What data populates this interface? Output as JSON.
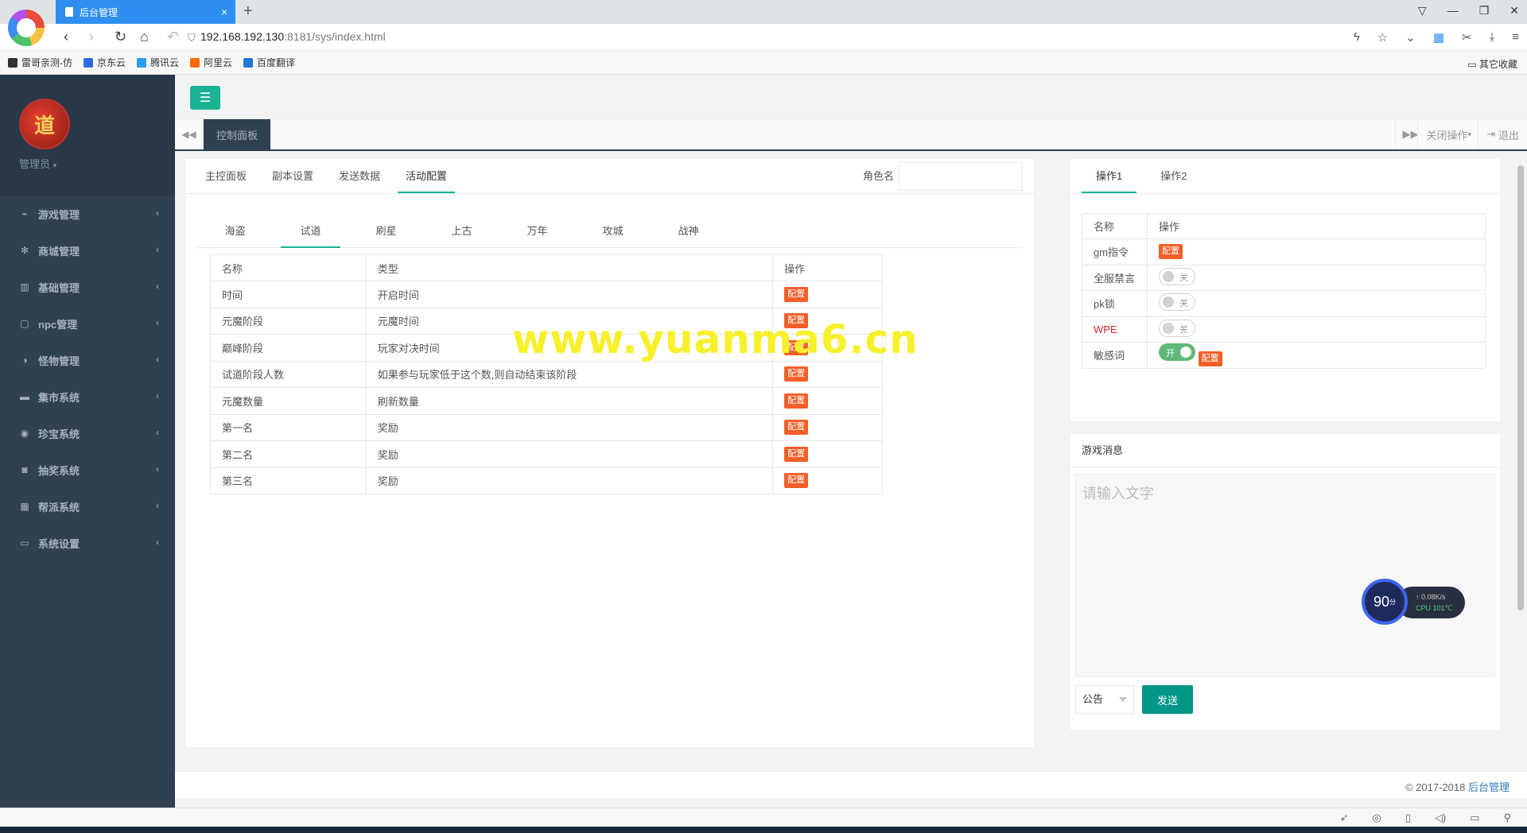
{
  "browser": {
    "tab_title": "后台管理",
    "url_host": "192.168.192.130",
    "url_rest": ":8181/sys/index.html",
    "bookmarks": [
      "雷哥亲测-仿",
      "京东云",
      "腾讯云",
      "阿里云",
      "百度翻译"
    ],
    "bookmark_colors": [
      "#333333",
      "#2b6de0",
      "#2b9af3",
      "#ff6a00",
      "#2277dd"
    ],
    "other_bookmarks": "其它收藏"
  },
  "sidebar": {
    "admin_label": "管理员",
    "avatar_text": "道",
    "items": [
      {
        "label": "游戏管理",
        "icon": "gamepad-icon",
        "glyph": "⌁"
      },
      {
        "label": "商城管理",
        "icon": "gear-icon",
        "glyph": "✻"
      },
      {
        "label": "基础管理",
        "icon": "building-icon",
        "glyph": "▥"
      },
      {
        "label": "npc管理",
        "icon": "square-icon",
        "glyph": "▢"
      },
      {
        "label": "怪物管理",
        "icon": "adjust-icon",
        "glyph": "◑"
      },
      {
        "label": "集市系统",
        "icon": "bed-icon",
        "glyph": "▬"
      },
      {
        "label": "珍宝系统",
        "icon": "target-icon",
        "glyph": "◉"
      },
      {
        "label": "抽奖系统",
        "icon": "camera-icon",
        "glyph": "◙"
      },
      {
        "label": "帮派系统",
        "icon": "grid-icon",
        "glyph": "▦"
      },
      {
        "label": "系统设置",
        "icon": "monitor-icon",
        "glyph": "▭"
      }
    ]
  },
  "topbar": {
    "hamburger_glyph": "☰",
    "active_page": "控制面板",
    "close_ops": "关闭操作",
    "logout": "退出"
  },
  "left_panel": {
    "tabs": [
      "主控面板",
      "副本设置",
      "发送数据",
      "活动配置"
    ],
    "active_tab": 3,
    "role_label": "角色名",
    "role_value": "",
    "sub_tabs": [
      "海盗",
      "试道",
      "刷星",
      "上古",
      "万年",
      "攻城",
      "战神"
    ],
    "active_sub_tab": 1,
    "table": {
      "headers": [
        "名称",
        "类型",
        "操作"
      ],
      "action_label": "配置",
      "rows": [
        {
          "name": "时间",
          "type": "开启时间"
        },
        {
          "name": "元魔阶段",
          "type": "元魔时间"
        },
        {
          "name": "巅峰阶段",
          "type": "玩家对决时间"
        },
        {
          "name": "试道阶段人数",
          "type": "如果参与玩家低于这个数,则自动结束该阶段"
        },
        {
          "name": "元魔数量",
          "type": "刷新数量"
        },
        {
          "name": "第一名",
          "type": "奖励"
        },
        {
          "name": "第二名",
          "type": "奖励"
        },
        {
          "name": "第三名",
          "type": "奖励"
        }
      ]
    }
  },
  "right_panel": {
    "tabs": [
      "操作1",
      "操作2"
    ],
    "active_tab": 0,
    "table": {
      "headers": [
        "名称",
        "操作"
      ],
      "rows": [
        {
          "name": "gm指令",
          "kind": "button",
          "button": "配置"
        },
        {
          "name": "全服禁言",
          "kind": "toggle",
          "toggle": "关",
          "on": false
        },
        {
          "name": "pk锁",
          "kind": "toggle",
          "toggle": "关",
          "on": false
        },
        {
          "name": "WPE",
          "kind": "toggle",
          "toggle": "关",
          "on": false,
          "color": "#e02020"
        },
        {
          "name": "敏感词",
          "kind": "toggle+button",
          "toggle": "开",
          "on": true,
          "button": "配置"
        }
      ]
    }
  },
  "messages": {
    "title": "游戏消息",
    "placeholder": "请输入文字",
    "select_value": "公告",
    "send_label": "发送"
  },
  "watermark": "www.yuanma6.cn",
  "speed_widget": {
    "score": "90",
    "score_unit": "分",
    "net": "↑ 0.08K/s",
    "cpu": "CPU 101℃"
  },
  "footer": {
    "copyright": "© 2017-2018 ",
    "link": "后台管理"
  },
  "colors": {
    "accent": "#1ab394",
    "sidebar": "#2f4050",
    "config_tag": "#f35f28",
    "send": "#009688"
  }
}
